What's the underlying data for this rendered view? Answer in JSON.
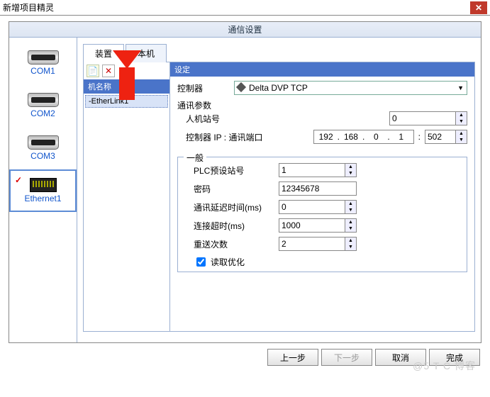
{
  "window": {
    "title": "新增项目精灵",
    "close": "✕"
  },
  "section": {
    "title": "通信设置"
  },
  "sidebar": {
    "items": [
      {
        "label": "COM1"
      },
      {
        "label": "COM2"
      },
      {
        "label": "COM3"
      },
      {
        "label": "Ethernet1"
      }
    ]
  },
  "tabs": {
    "device": "装置",
    "local": "本机"
  },
  "device_list": {
    "header": "机名称",
    "items": [
      "-EtherLink1"
    ],
    "add_icon": "📄",
    "del_icon": "✕"
  },
  "settings": {
    "header": "设定",
    "controller_label": "控制器",
    "controller_value": "Delta DVP TCP",
    "comm_params": "通讯参数",
    "hmi_station_label": "人机站号",
    "hmi_station_value": "0",
    "controller_ip_label": "控制器 IP : 通讯端口",
    "ip": {
      "a": "192",
      "b": "168",
      "c": "0",
      "d": "1"
    },
    "port_sep": ":",
    "port_value": "502",
    "general_legend": "一般",
    "plc_station_label": "PLC预设站号",
    "plc_station_value": "1",
    "password_label": "密码",
    "password_value": "12345678",
    "delay_label": "通讯延迟时间(ms)",
    "delay_value": "0",
    "timeout_label": "连接超时(ms)",
    "timeout_value": "1000",
    "retry_label": "重送次数",
    "retry_value": "2",
    "read_opt_label": "读取优化"
  },
  "footer": {
    "prev": "上一步",
    "next": "下一步",
    "cancel": "取消",
    "finish": "完成"
  },
  "watermark": "@5 T C 博客"
}
